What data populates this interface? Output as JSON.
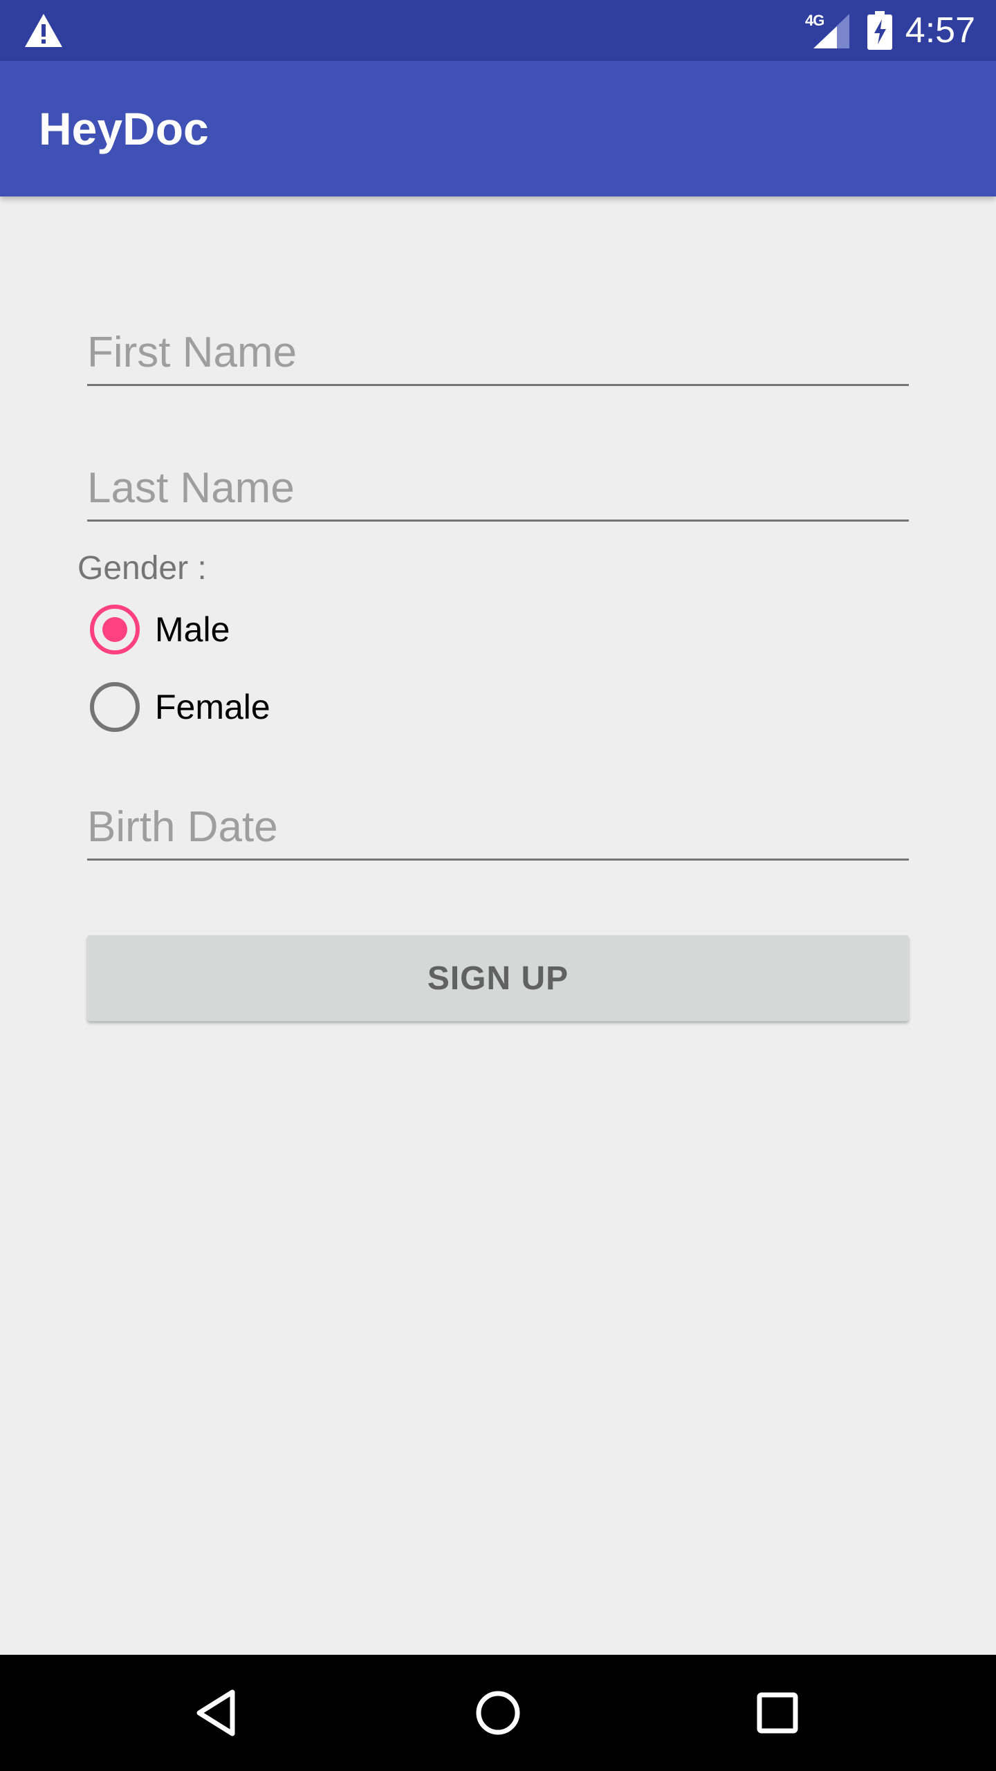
{
  "status_bar": {
    "time": "4:57",
    "network_label": "4G",
    "icons": [
      "warning-icon",
      "signal-icon",
      "battery-charging-icon"
    ]
  },
  "app_bar": {
    "title": "HeyDoc"
  },
  "form": {
    "first_name": {
      "placeholder": "First Name",
      "value": ""
    },
    "last_name": {
      "placeholder": "Last Name",
      "value": ""
    },
    "gender_label": "Gender :",
    "gender_options": [
      {
        "label": "Male",
        "checked": true
      },
      {
        "label": "Female",
        "checked": false
      }
    ],
    "birth_date": {
      "placeholder": "Birth Date",
      "value": ""
    },
    "signup_label": "SIGN UP"
  },
  "nav_bar": {
    "icons": [
      "back-icon",
      "home-icon",
      "recents-icon"
    ]
  },
  "colors": {
    "status_bar": "#303F9F",
    "app_bar": "#3F51B5",
    "accent": "#FF4081",
    "background": "#EEEEEE"
  }
}
